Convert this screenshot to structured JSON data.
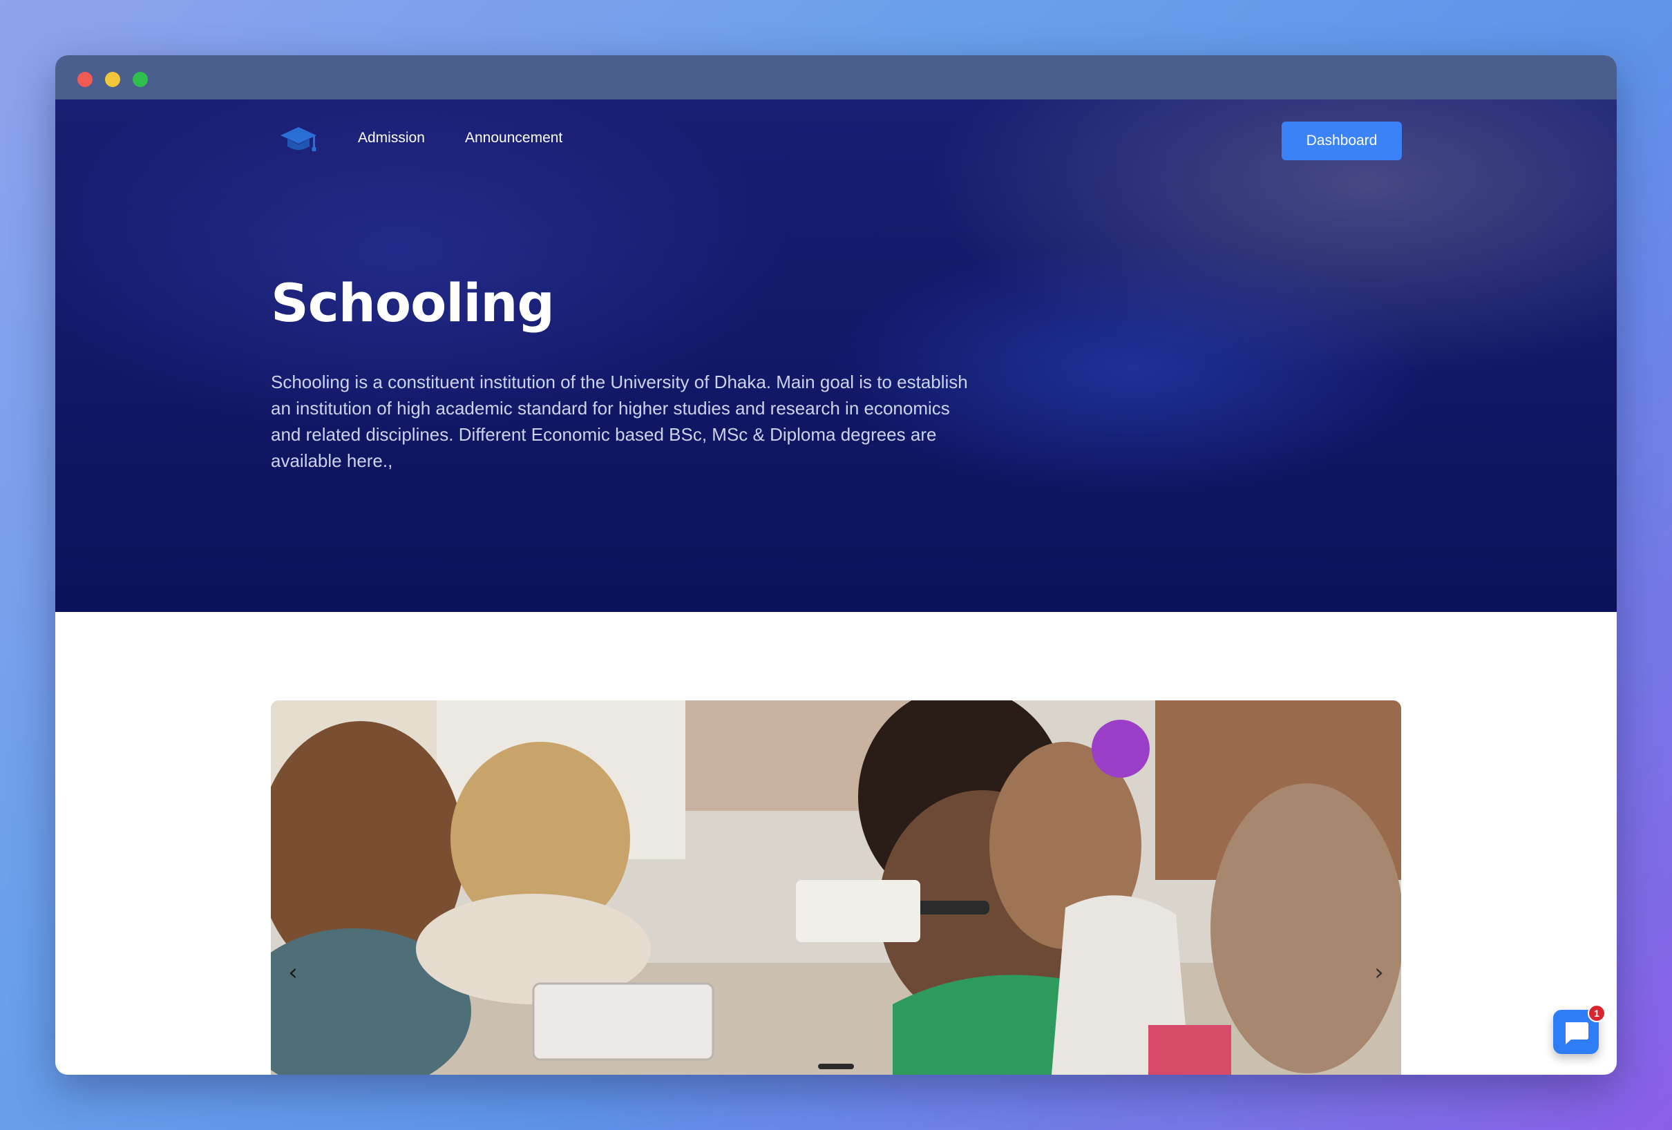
{
  "nav": {
    "logo_icon": "graduation-cap-icon",
    "links": [
      "Admission",
      "Announcement"
    ],
    "dashboard_label": "Dashboard"
  },
  "hero": {
    "title": "Schooling",
    "description": "Schooling is a constituent institution of the University of Dhaka. Main goal is to establish an institution of high academic standard for higher studies and research in economics and related disciplines. Different Economic based BSc, MSc & Diploma degrees are available here.,"
  },
  "carousel": {
    "prev_icon": "chevron-left-icon",
    "next_icon": "chevron-right-icon"
  },
  "chat": {
    "icon": "chat-bubble-icon",
    "badge_count": "1"
  },
  "colors": {
    "accent": "#3b82f6",
    "hero_bg": "#121766",
    "badge": "#d9252f"
  }
}
